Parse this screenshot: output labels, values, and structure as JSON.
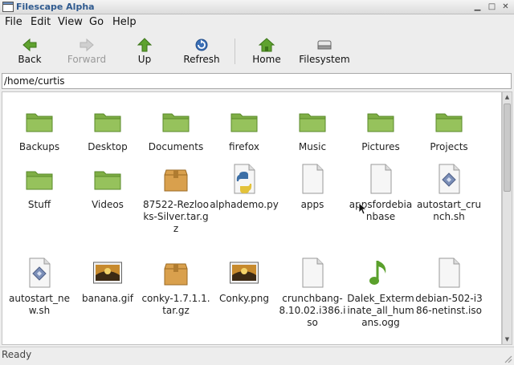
{
  "window": {
    "title": "Filescape Alpha"
  },
  "menu": [
    "File",
    "Edit",
    "View",
    "Go",
    "Help"
  ],
  "toolbar": {
    "back": "Back",
    "forward": "Forward",
    "up": "Up",
    "refresh": "Refresh",
    "home": "Home",
    "filesystem": "Filesystem"
  },
  "location": {
    "path": "/home/curtis"
  },
  "files": [
    {
      "name": "Backups",
      "icon": "folder-icon"
    },
    {
      "name": "Desktop",
      "icon": "folder-icon"
    },
    {
      "name": "Documents",
      "icon": "folder-icon"
    },
    {
      "name": "firefox",
      "icon": "folder-icon"
    },
    {
      "name": "Music",
      "icon": "folder-icon"
    },
    {
      "name": "Pictures",
      "icon": "folder-icon"
    },
    {
      "name": "Projects",
      "icon": "folder-icon"
    },
    {
      "name": "Stuff",
      "icon": "folder-icon"
    },
    {
      "name": "Videos",
      "icon": "folder-icon"
    },
    {
      "name": "87522-Rezlooks-Silver.tar.gz",
      "icon": "archive-icon"
    },
    {
      "name": "alphademo.py",
      "icon": "python-file-icon"
    },
    {
      "name": "apps",
      "icon": "text-file-icon"
    },
    {
      "name": "appsfordebianbase",
      "icon": "text-file-icon"
    },
    {
      "name": "autostart_crunch.sh",
      "icon": "script-file-icon"
    },
    {
      "name": "autostart_new.sh",
      "icon": "script-file-icon"
    },
    {
      "name": "banana.gif",
      "icon": "image-file-icon"
    },
    {
      "name": "conky-1.7.1.1.tar.gz",
      "icon": "archive-icon"
    },
    {
      "name": "Conky.png",
      "icon": "image-file-icon"
    },
    {
      "name": "crunchbang-8.10.02.i386.iso",
      "icon": "text-file-icon"
    },
    {
      "name": "Dalek_Exterminate_all_humans.ogg",
      "icon": "audio-file-icon"
    },
    {
      "name": "debian-502-i386-netinst.iso",
      "icon": "text-file-icon"
    }
  ],
  "status": {
    "text": "Ready"
  }
}
